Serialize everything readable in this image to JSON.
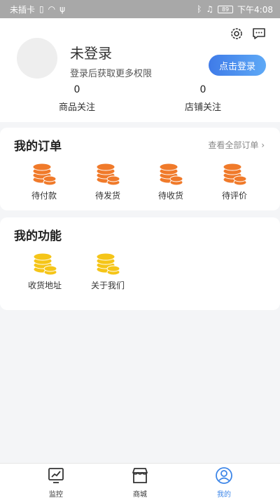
{
  "status_bar": {
    "left_text": "未插卡",
    "battery": "89",
    "time": "下午4:08"
  },
  "profile": {
    "title": "未登录",
    "subtitle": "登录后获取更多权限",
    "login_button": "点击登录",
    "stats": [
      {
        "value": "0",
        "label": "商品关注"
      },
      {
        "value": "0",
        "label": "店铺关注"
      }
    ]
  },
  "orders": {
    "title": "我的订单",
    "more": "查看全部订单 ›",
    "items": [
      {
        "label": "待付款",
        "icon": "coins-icon"
      },
      {
        "label": "待发货",
        "icon": "coins-icon"
      },
      {
        "label": "待收货",
        "icon": "coins-icon"
      },
      {
        "label": "待评价",
        "icon": "coins-icon"
      }
    ],
    "icon_color": "#f07a2a"
  },
  "functions": {
    "title": "我的功能",
    "items": [
      {
        "label": "收货地址",
        "icon": "coins-icon"
      },
      {
        "label": "关于我们",
        "icon": "coins-icon"
      }
    ],
    "icon_color": "#f5c518"
  },
  "tabbar": {
    "tabs": [
      {
        "label": "监控",
        "icon": "monitor-chart-icon"
      },
      {
        "label": "商城",
        "icon": "store-icon"
      },
      {
        "label": "我的",
        "icon": "user-icon"
      }
    ],
    "active_color": "#3d86e8"
  }
}
